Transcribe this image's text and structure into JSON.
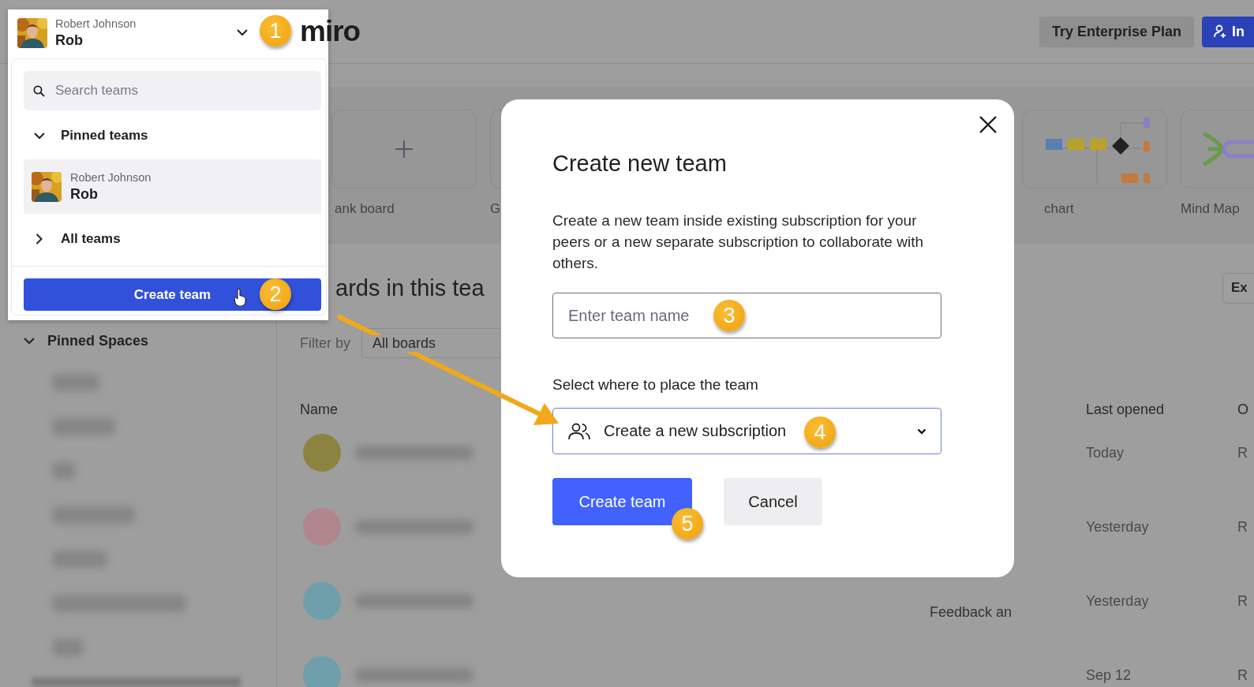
{
  "header": {
    "logo": "miro",
    "buttons": [
      {
        "label": "Try Enterprise Plan",
        "kind": "secondary"
      },
      {
        "label": "In",
        "kind": "invite"
      }
    ]
  },
  "sidebar": {
    "section": {
      "label": "Pinned Spaces",
      "expanded": true
    }
  },
  "templates": [
    {
      "label": "ank board",
      "kind": "blank"
    },
    {
      "label": "G",
      "kind": "generic"
    },
    {
      "label": "chart",
      "kind": "flowchart"
    },
    {
      "label": "Mind Map",
      "kind": "mindmap"
    }
  ],
  "boards": {
    "heading": "ards in this tea",
    "export_button": "Ex",
    "filter": {
      "label": "Filter by",
      "value": "All boards"
    },
    "columns": [
      "Name",
      "Last opened",
      "O"
    ],
    "rows": [
      {
        "color": "#8a8440",
        "last_opened": "Today",
        "column_3": "R"
      },
      {
        "color": "#b0868c",
        "last_opened": "Yesterday",
        "column_3": "R"
      },
      {
        "color": "#6f9fab",
        "column_2": "Feedback an",
        "last_opened": "Yesterday",
        "column_3": "R"
      },
      {
        "color": "#6f9fab",
        "last_opened": "Sep 12",
        "column_3": "R"
      }
    ]
  },
  "team_menu": {
    "current": {
      "subtitle": "Robert Johnson",
      "name": "Rob"
    },
    "search": {
      "placeholder": "Search teams"
    },
    "sections": [
      {
        "label": "Pinned teams",
        "expanded": true,
        "teams": [
          {
            "subtitle": "Robert Johnson",
            "name": "Rob"
          }
        ]
      },
      {
        "label": "All teams",
        "expanded": false
      }
    ],
    "create_button": "Create team"
  },
  "dialog": {
    "title": "Create new team",
    "description": "Create a new team inside existing subscription for your peers or a new separate subscription to collaborate with others.",
    "name_field": {
      "placeholder": "Enter team name"
    },
    "placement": {
      "label": "Select where to place the team",
      "value": "Create a new subscription"
    },
    "buttons": [
      {
        "label": "Create team",
        "kind": "primary"
      },
      {
        "label": "Cancel",
        "kind": "secondary"
      }
    ]
  },
  "callouts": [
    "1",
    "2",
    "3",
    "4",
    "5"
  ]
}
